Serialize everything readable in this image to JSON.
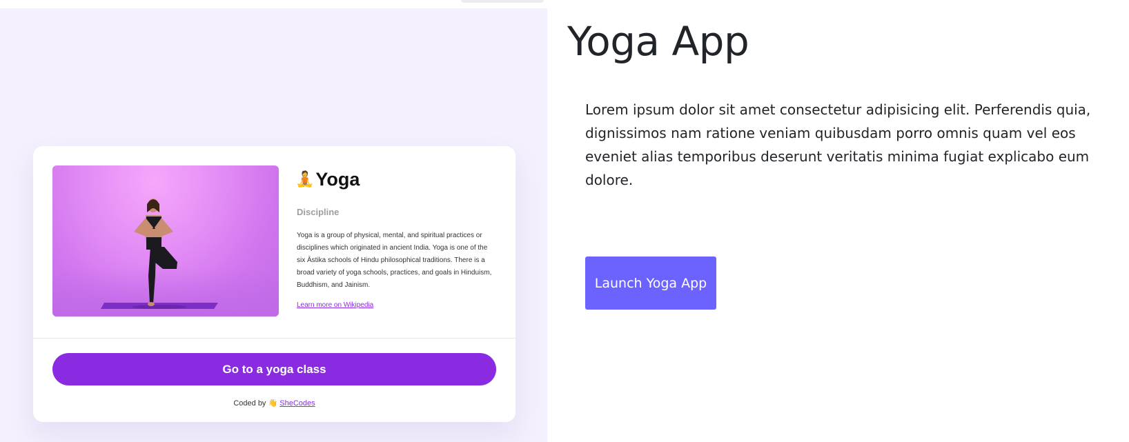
{
  "card": {
    "title_icon": "person-in-lotus-position-icon",
    "title": "Yoga",
    "subtitle": "Discipline",
    "description": "Yoga is a group of physical, mental, and spiritual practices or disciplines which originated in ancient India. Yoga is one of the six Āstika schools of Hindu philosophical traditions. There is a broad variety of yoga schools, practices, and goals in Hinduism, Buddhism, and Jainism.",
    "link_label": "Learn more on Wikipedia",
    "button_label": "Go to a yoga class",
    "footer_prefix": "Coded by",
    "footer_icon": "waving-hand-icon",
    "footer_link": "SheCodes",
    "image_icon": "yoga-tree-pose-photo"
  },
  "main": {
    "title": "Yoga App",
    "description": "Lorem ipsum dolor sit amet consectetur adipisicing elit. Perferendis quia, dignissimos nam ratione veniam quibusdam porro omnis quam vel eos eveniet alias temporibus deserunt veritatis minima fugiat explicabo eum dolore.",
    "launch_label": "Launch Yoga App"
  },
  "colors": {
    "left_bg": "#f4f0fd",
    "accent_purple": "#8a2be2",
    "launch_button": "#6c63ff",
    "text_dark": "#212529"
  }
}
